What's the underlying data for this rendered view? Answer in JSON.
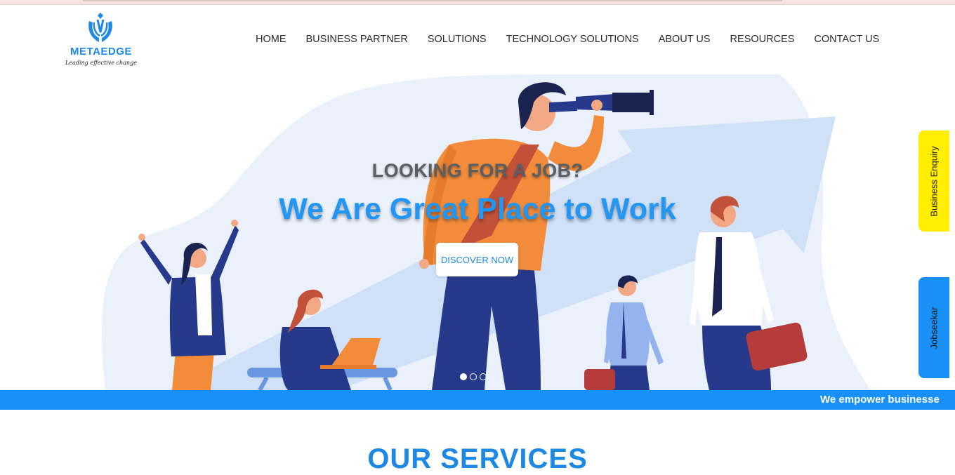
{
  "brand": {
    "name": "METAEDGE",
    "tagline": "Leading effective change",
    "color": "#1e88e5"
  },
  "nav": {
    "items": [
      "HOME",
      "BUSINESS PARTNER",
      "SOLUTIONS",
      "TECHNOLOGY SOLUTIONS",
      "ABOUT US",
      "RESOURCES",
      "CONTACT US"
    ]
  },
  "hero": {
    "kicker": "LOOKING FOR A JOB?",
    "title": "We Are Great Place to Work",
    "button": "DISCOVER NOW",
    "slides": 3,
    "active_slide": 1
  },
  "ticker": {
    "text": "We empower businesse"
  },
  "side_tabs": {
    "business": "Business Enquiry",
    "jobseeker": "Jobseekar"
  },
  "services": {
    "title": "OUR SERVICES"
  },
  "colors": {
    "primary_blue": "#1990f5",
    "tab_yellow": "#ffee00",
    "orange_shirt": "#f28c3a",
    "navy": "#27398a"
  }
}
